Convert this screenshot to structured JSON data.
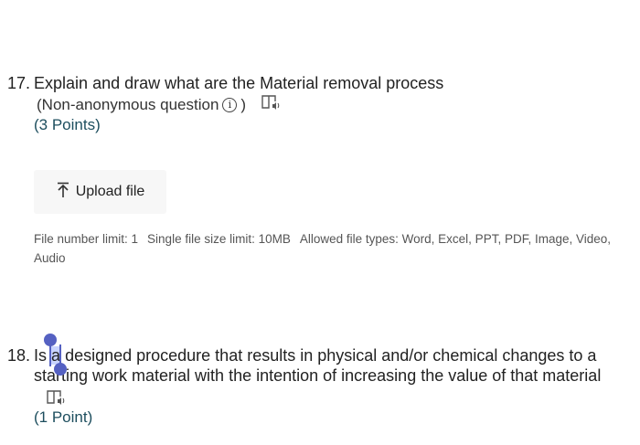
{
  "questions": [
    {
      "number": "17.",
      "title": "Explain and draw what are the Material removal process",
      "subtitle": "(Non-anonymous question",
      "subtitle_close": ")",
      "info_glyph": "i",
      "points": "(3 Points)",
      "upload_label": "Upload file",
      "hint": {
        "limit": "File number limit: 1",
        "size": "Single file size limit: 10MB",
        "types": "Allowed file types: Word, Excel, PPT, PDF, Image, Video, Audio"
      }
    },
    {
      "number": "18.",
      "title_before": "Is ",
      "title_selected": "a",
      "title_after": " designed procedure that results in physical and/or chemical changes to a",
      "title_line2": "starting work material with the intention of increasing the value of that material",
      "points": "(1 Point)"
    }
  ],
  "icons": {
    "reader": "immersive-reader-icon",
    "info": "info-icon",
    "upload": "upload-arrow-icon"
  },
  "colors": {
    "points": "#1d4e5e",
    "selection": "#c9d4ff",
    "handle": "#5561c2"
  }
}
